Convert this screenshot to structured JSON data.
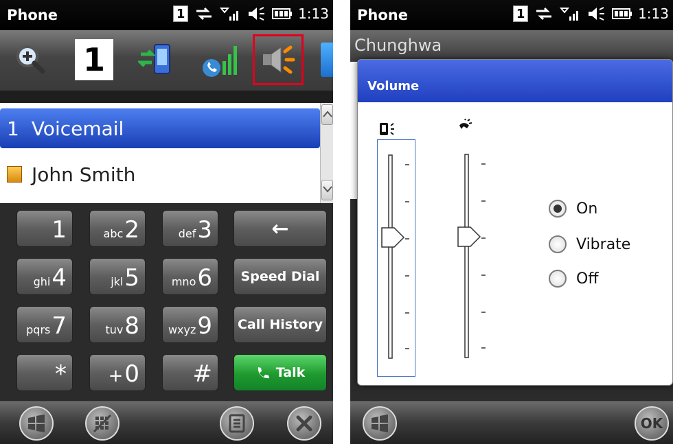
{
  "left": {
    "title": "Phone",
    "line_indicator": "1",
    "clock": "1:13",
    "toolbar": {
      "items": [
        {
          "icon": "zoom-in-icon"
        },
        {
          "icon": "line-one-icon",
          "label": "1"
        },
        {
          "icon": "device-transfer-icon"
        },
        {
          "icon": "call-signal-icon"
        },
        {
          "icon": "speaker-volume-icon",
          "selected": true
        },
        {
          "icon": "more-icon"
        }
      ]
    },
    "recent": [
      {
        "num": "1",
        "label": "Voicemail",
        "highlighted": true
      },
      {
        "label": "John Smith",
        "icon": "contact-card-icon"
      }
    ],
    "keypad": [
      {
        "letters": "",
        "digit": "1"
      },
      {
        "letters": "abc",
        "digit": "2"
      },
      {
        "letters": "def",
        "digit": "3"
      },
      {
        "label": "←",
        "name": "backspace"
      },
      {
        "letters": "ghi",
        "digit": "4"
      },
      {
        "letters": "jkl",
        "digit": "5"
      },
      {
        "letters": "mno",
        "digit": "6"
      },
      {
        "label": "Speed Dial",
        "name": "speed-dial"
      },
      {
        "letters": "pqrs",
        "digit": "7"
      },
      {
        "letters": "tuv",
        "digit": "8"
      },
      {
        "letters": "wxyz",
        "digit": "9"
      },
      {
        "label": "Call History",
        "name": "call-history"
      },
      {
        "letters": "",
        "digit": "*"
      },
      {
        "letters": "+",
        "digit": "0"
      },
      {
        "letters": "",
        "digit": "#"
      },
      {
        "label": "Talk",
        "name": "talk"
      }
    ]
  },
  "right": {
    "title": "Phone",
    "line_indicator": "1",
    "clock": "1:13",
    "carrier": "Chunghwa",
    "dialog": {
      "title": "Volume",
      "ringer_level": 0.5,
      "incall_level": 0.5,
      "modes": [
        {
          "label": "On",
          "selected": true
        },
        {
          "label": "Vibrate",
          "selected": false
        },
        {
          "label": "Off",
          "selected": false
        }
      ]
    },
    "ok_label": "OK"
  },
  "colors": {
    "accent_blue": "#2f55d4",
    "selection_red": "#e3001b",
    "talk_green": "#1f9a2e"
  }
}
